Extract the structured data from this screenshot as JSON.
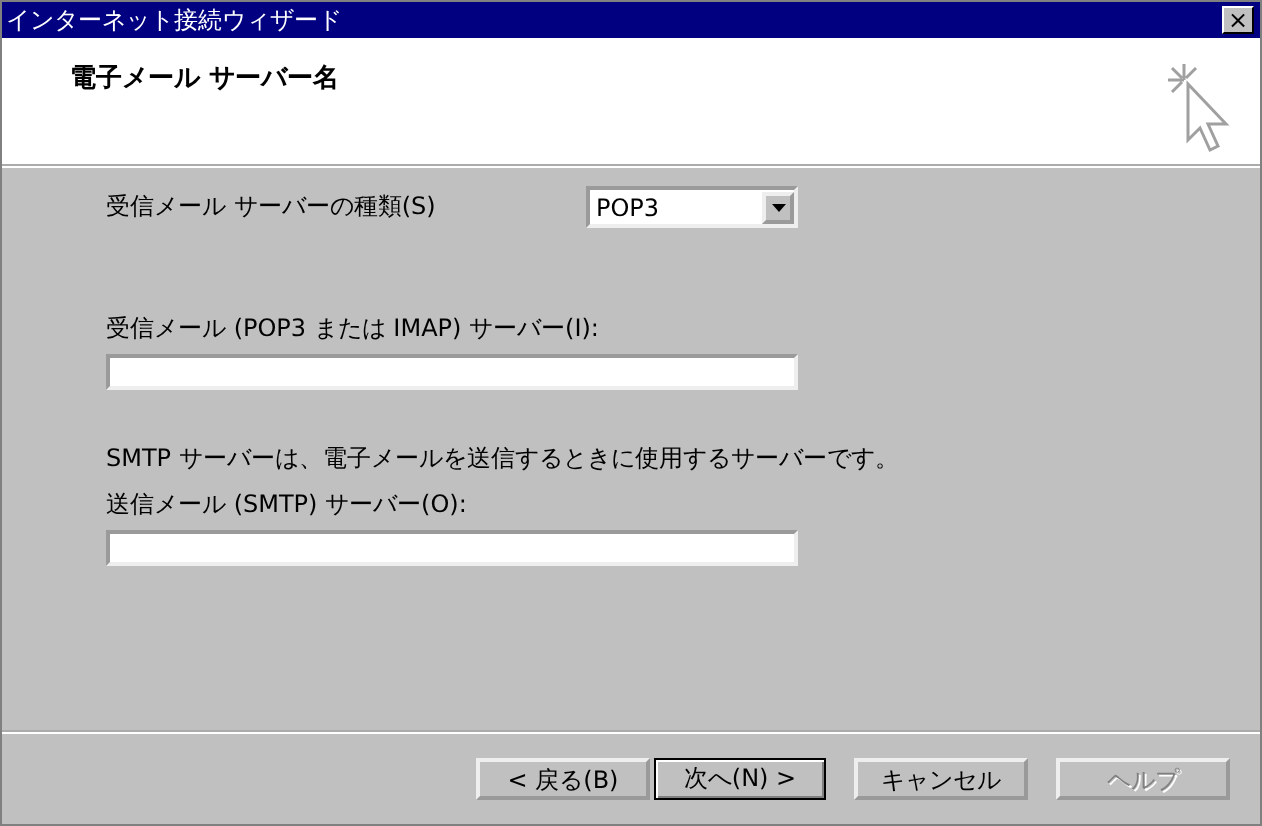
{
  "window": {
    "title": "インターネット接続ウィザード",
    "close": "×"
  },
  "header": {
    "title": "電子メール サーバー名"
  },
  "server_type": {
    "label": "受信メール サーバーの種類(S)",
    "value": "POP3"
  },
  "incoming": {
    "label": "受信メール (POP3 または IMAP) サーバー(I):"
  },
  "smtp_note": "SMTP サーバーは、電子メールを送信するときに使用するサーバーです。",
  "outgoing": {
    "label": "送信メール (SMTP) サーバー(O):"
  },
  "buttons": [
    {
      "label": "< 戻る(B)",
      "default": false,
      "disabled": false
    },
    {
      "label": "次へ(N) >",
      "default": true,
      "disabled": false
    },
    {
      "label": "キャンセル",
      "default": false,
      "disabled": false
    },
    {
      "label": "ヘルプ",
      "default": false,
      "disabled": true
    }
  ]
}
